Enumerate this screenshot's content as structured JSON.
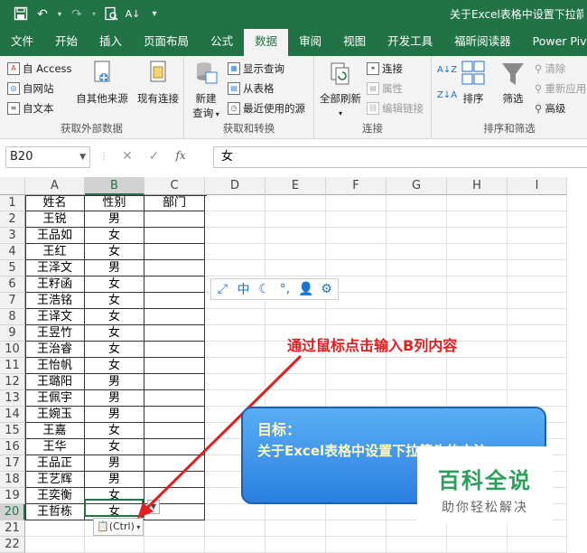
{
  "title_bar": {
    "doc_title": "关于Excel表格中设置下拉箭头的方法"
  },
  "tabs": [
    "文件",
    "开始",
    "插入",
    "页面布局",
    "公式",
    "数据",
    "审阅",
    "视图",
    "开发工具",
    "福昕阅读器",
    "Power Pivot"
  ],
  "active_tab": "数据",
  "ribbon": {
    "get_external": {
      "label": "获取外部数据",
      "from_access": "自 Access",
      "from_web": "自网站",
      "from_text": "自文本",
      "from_other": "自其他来源",
      "existing": "现有连接"
    },
    "get_transform": {
      "label": "获取和转换",
      "new_query": "新建",
      "new_query2": "查询",
      "show_queries": "显示查询",
      "from_table": "从表格",
      "recent_sources": "最近使用的源"
    },
    "connections": {
      "label": "连接",
      "refresh_all": "全部刷新",
      "connections": "连接",
      "properties": "属性",
      "edit_links": "编辑链接"
    },
    "sort_filter": {
      "label": "排序和筛选",
      "sort": "排序",
      "filter": "筛选",
      "clear": "清除",
      "reapply": "重新应用",
      "advanced": "高级"
    }
  },
  "formula_bar": {
    "name_box": "B20",
    "value": "女"
  },
  "columns": [
    "A",
    "B",
    "C",
    "D",
    "E",
    "F",
    "G",
    "H",
    "I"
  ],
  "selected_column": "B",
  "selected_row": "20",
  "rows": [
    {
      "num": "1",
      "a": "姓名",
      "b": "性别",
      "c": "部门"
    },
    {
      "num": "2",
      "a": "王锐",
      "b": "男",
      "c": ""
    },
    {
      "num": "3",
      "a": "王品如",
      "b": "女",
      "c": ""
    },
    {
      "num": "4",
      "a": "王红",
      "b": "女",
      "c": ""
    },
    {
      "num": "5",
      "a": "王泽文",
      "b": "男",
      "c": ""
    },
    {
      "num": "6",
      "a": "王籽函",
      "b": "女",
      "c": ""
    },
    {
      "num": "7",
      "a": "王浩铭",
      "b": "女",
      "c": ""
    },
    {
      "num": "8",
      "a": "王译文",
      "b": "女",
      "c": ""
    },
    {
      "num": "9",
      "a": "王昱竹",
      "b": "女",
      "c": ""
    },
    {
      "num": "10",
      "a": "王治睿",
      "b": "女",
      "c": ""
    },
    {
      "num": "11",
      "a": "王怡帆",
      "b": "女",
      "c": ""
    },
    {
      "num": "12",
      "a": "王璐阳",
      "b": "男",
      "c": ""
    },
    {
      "num": "13",
      "a": "王佩宇",
      "b": "男",
      "c": ""
    },
    {
      "num": "14",
      "a": "王婉玉",
      "b": "男",
      "c": ""
    },
    {
      "num": "15",
      "a": "王嘉",
      "b": "女",
      "c": ""
    },
    {
      "num": "16",
      "a": "王华",
      "b": "女",
      "c": ""
    },
    {
      "num": "17",
      "a": "王品正",
      "b": "男",
      "c": ""
    },
    {
      "num": "18",
      "a": "王艺辉",
      "b": "男",
      "c": ""
    },
    {
      "num": "19",
      "a": "王奕衡",
      "b": "女",
      "c": ""
    },
    {
      "num": "20",
      "a": "王哲栋",
      "b": "女",
      "c": ""
    },
    {
      "num": "21",
      "a": "",
      "b": "",
      "c": ""
    },
    {
      "num": "22",
      "a": "",
      "b": "",
      "c": ""
    }
  ],
  "paste_options": "(Ctrl)",
  "ime_toolbar": {
    "mode": "中"
  },
  "annotation": "通过鼠标点击输入B列内容",
  "goal_box": {
    "title": "目标：",
    "text": "关于Excel表格中设置下拉箭头的方法"
  },
  "watermark": {
    "brand": "百科全说",
    "slogan": "助你轻松解决"
  }
}
